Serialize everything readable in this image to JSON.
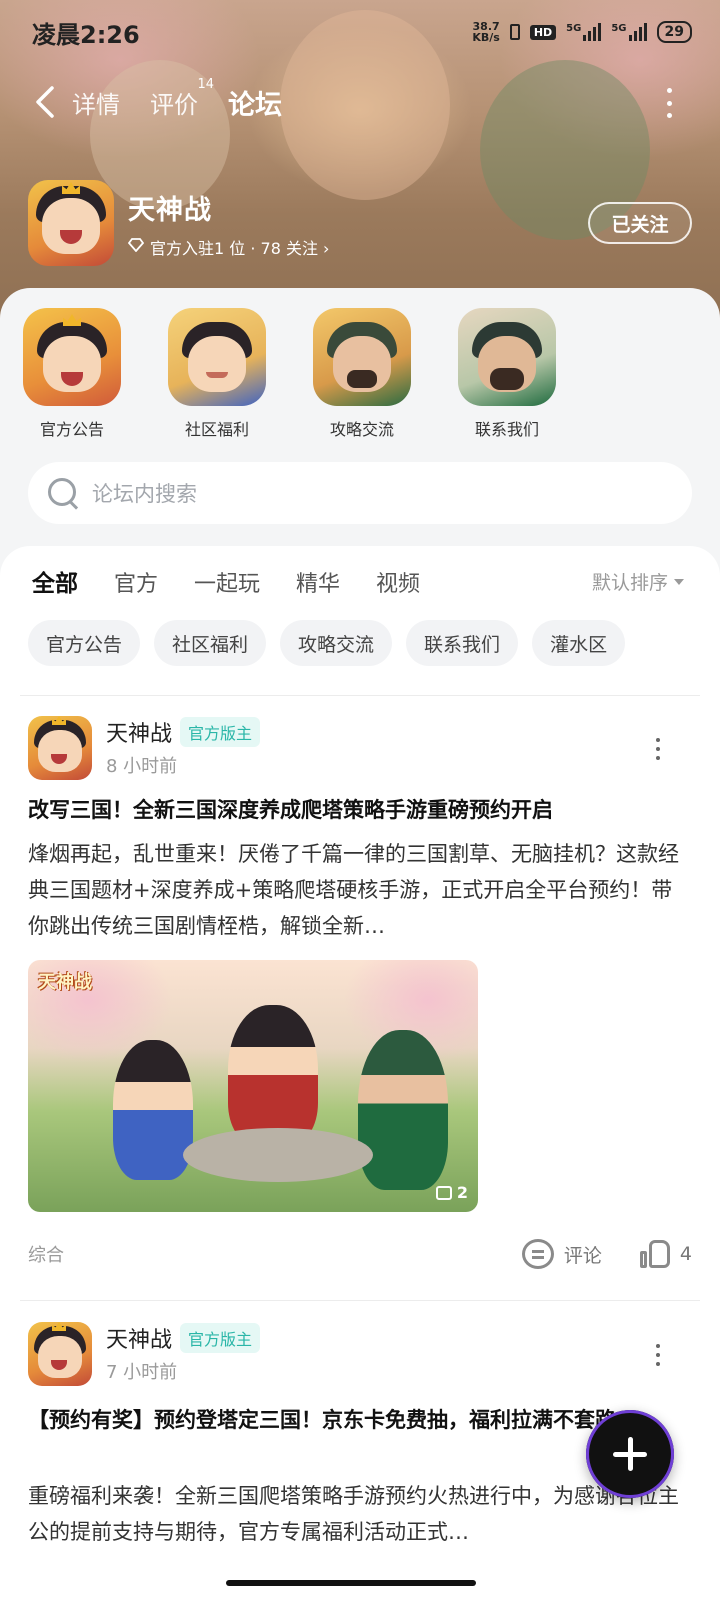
{
  "status_bar": {
    "time": "凌晨2:26",
    "net_speed_value": "38.7",
    "net_speed_unit": "KB/s",
    "hd_label": "HD",
    "signal1_label": "5G",
    "signal2_label": "5G",
    "battery": "29"
  },
  "nav": {
    "tabs": [
      {
        "label": "详情",
        "badge": ""
      },
      {
        "label": "评价",
        "badge": "14"
      },
      {
        "label": "论坛",
        "badge": ""
      }
    ],
    "active_tab": "论坛"
  },
  "game": {
    "name": "天神战",
    "meta": "官方入驻1 位 · 78 关注 ›",
    "follow_label": "已关注"
  },
  "sections": [
    {
      "label": "官方公告"
    },
    {
      "label": "社区福利"
    },
    {
      "label": "攻略交流"
    },
    {
      "label": "联系我们"
    }
  ],
  "search": {
    "placeholder": "论坛内搜索"
  },
  "feed": {
    "tabs": [
      "全部",
      "官方",
      "一起玩",
      "精华",
      "视频"
    ],
    "sort_label": "默认排序",
    "chips": [
      "官方公告",
      "社区福利",
      "攻略交流",
      "联系我们",
      "灌水区"
    ]
  },
  "posts": [
    {
      "author": "天神战",
      "badge": "官方版主",
      "time": "8 小时前",
      "title": "改写三国！全新三国深度养成爬塔策略手游重磅预约开启",
      "body": "烽烟再起，乱世重来！厌倦了千篇一律的三国割草、无脑挂机？这款经典三国题材+深度养成+策略爬塔硬核手游，正式开启全平台预约！带你跳出传统三国剧情桎梏，解锁全新…",
      "image_logo": "天神战",
      "image_count": "2",
      "tag": "综合",
      "comment_label": "评论",
      "likes": "4"
    },
    {
      "author": "天神战",
      "badge": "官方版主",
      "time": "7 小时前",
      "title": "【预约有奖】预约登塔定三国！京东卡免费抽，福利拉满不套路",
      "body": "重磅福利来袭！全新三国爬塔策略手游预约火热进行中，为感谢各位主公的提前支持与期待，官方专属福利活动正式…"
    }
  ],
  "colors": {
    "accent": "#3fd1c4",
    "badge_text": "#2ab6a8",
    "badge_bg": "#e5f8f5"
  },
  "icons": [
    "back-arrow-icon",
    "more-vertical-icon",
    "diamond-icon",
    "search-icon",
    "caret-down-icon",
    "image-stack-icon",
    "comment-icon",
    "thumbs-up-icon",
    "plus-icon"
  ]
}
